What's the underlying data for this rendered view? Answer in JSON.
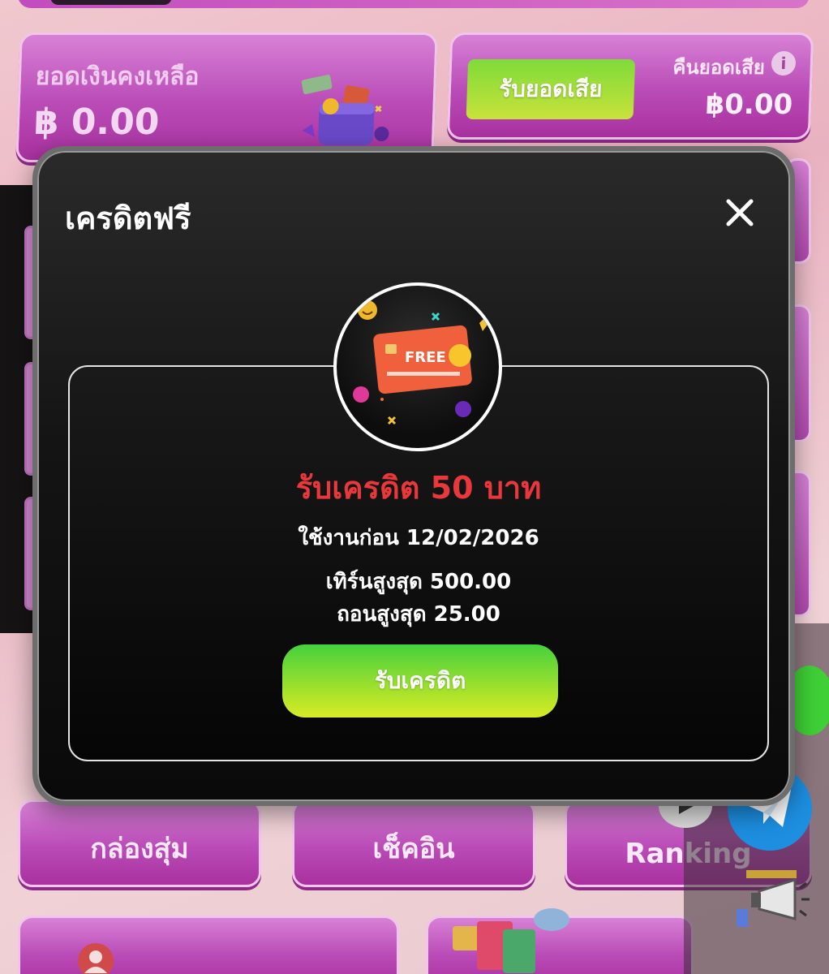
{
  "dashboard": {
    "balance_label": "ยอดเงินคงเหลือ",
    "balance_value": "฿ 0.00",
    "cashback_button": "รับยอดเสีย",
    "cashback_label": "คืนยอดเสีย",
    "cashback_value": "฿0.00",
    "info_icon_glyph": "i",
    "bottom_tiles": [
      "กล่องสุ่ม",
      "เช็คอิน",
      "Ranking"
    ]
  },
  "modal": {
    "title": "เครดิตฟรี",
    "badge_text": "FREE",
    "credit_amount": "รับเครดิต 50 บาท",
    "expiry": "ใช้งานก่อน 12/02/2026",
    "max_turnover": "เทิร์นสูงสุด 500.00",
    "max_withdraw": "ถอนสูงสุด 25.00",
    "claim_button": "รับเครดิต"
  },
  "colors": {
    "accent_red": "#e8383b",
    "button_green": "#45d13d",
    "card_pink": "#c35bc0",
    "telegram_blue": "#1d8ee0"
  },
  "icons": [
    "wallet-icon",
    "info-icon",
    "close-icon",
    "free-card-icon",
    "telegram-icon",
    "megaphone-icon"
  ]
}
